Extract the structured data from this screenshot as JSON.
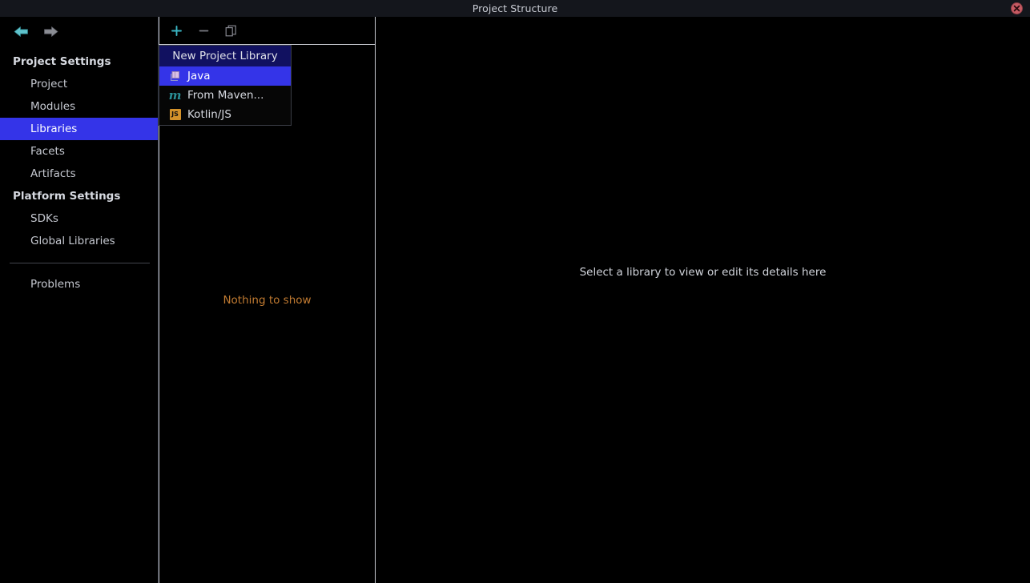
{
  "window": {
    "title": "Project Structure",
    "close_icon": "close-icon"
  },
  "navigation": {
    "back_icon": "arrow-left-icon",
    "forward_icon": "arrow-right-icon"
  },
  "sidebar": {
    "groups": [
      {
        "label": "Project Settings",
        "items": [
          {
            "label": "Project",
            "selected": false
          },
          {
            "label": "Modules",
            "selected": false
          },
          {
            "label": "Libraries",
            "selected": true
          },
          {
            "label": "Facets",
            "selected": false
          },
          {
            "label": "Artifacts",
            "selected": false
          }
        ]
      },
      {
        "label": "Platform Settings",
        "items": [
          {
            "label": "SDKs",
            "selected": false
          },
          {
            "label": "Global Libraries",
            "selected": false
          }
        ]
      }
    ],
    "extra_items": [
      {
        "label": "Problems",
        "selected": false
      }
    ]
  },
  "list_panel": {
    "toolbar": {
      "add_label": "+",
      "add_icon": "plus-icon",
      "remove_label": "−",
      "remove_icon": "minus-icon",
      "copy_icon": "copy-icon"
    },
    "empty_text": "Nothing to show"
  },
  "detail_panel": {
    "placeholder": "Select a library to view or edit its details here"
  },
  "popup_menu": {
    "header": "New Project Library",
    "items": [
      {
        "label": "Java",
        "icon": "java-library-icon",
        "selected": true
      },
      {
        "label": "From Maven...",
        "icon": "maven-icon",
        "selected": false
      },
      {
        "label": "Kotlin/JS",
        "icon": "kotlin-js-icon",
        "selected": false
      }
    ]
  },
  "colors": {
    "selection_blue": "#3434e8",
    "header_navy": "#111160",
    "accent_teal": "#3ab6c4",
    "warning_orange": "#c07a31",
    "close_red": "#c75a63",
    "js_orange": "#d4922a",
    "maven_teal": "#2a8f96"
  }
}
